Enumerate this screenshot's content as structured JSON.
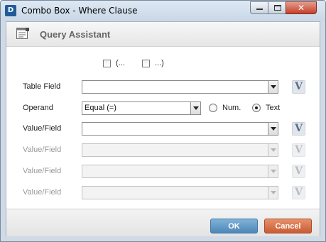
{
  "window": {
    "app_icon_letter": "D",
    "title": "Combo Box - Where Clause",
    "close_glyph": "✕"
  },
  "header": {
    "title": "Query Assistant",
    "icon": "query-assistant-icon"
  },
  "parens": {
    "open_label": "(...",
    "close_label": "...)",
    "open_checked": false,
    "close_checked": false
  },
  "rows": {
    "table_field": {
      "label": "Table Field",
      "value": "",
      "v_label": "V",
      "enabled": true
    },
    "operand": {
      "label": "Operand",
      "value": "Equal (=)",
      "radio_num_label": "Num.",
      "radio_text_label": "Text",
      "selected_type": "Text"
    },
    "value_field_1": {
      "label": "Value/Field",
      "value": "",
      "v_label": "V",
      "enabled": true
    },
    "value_field_2": {
      "label": "Value/Field",
      "value": "",
      "v_label": "V",
      "enabled": false
    },
    "value_field_3": {
      "label": "Value/Field",
      "value": "",
      "v_label": "V",
      "enabled": false
    },
    "value_field_4": {
      "label": "Value/Field",
      "value": "",
      "v_label": "V",
      "enabled": false
    }
  },
  "footer": {
    "ok_label": "OK",
    "cancel_label": "Cancel"
  },
  "colors": {
    "ok_button": "#5b93c1",
    "cancel_button": "#d36d44",
    "title_bar": "#cfdae6"
  }
}
